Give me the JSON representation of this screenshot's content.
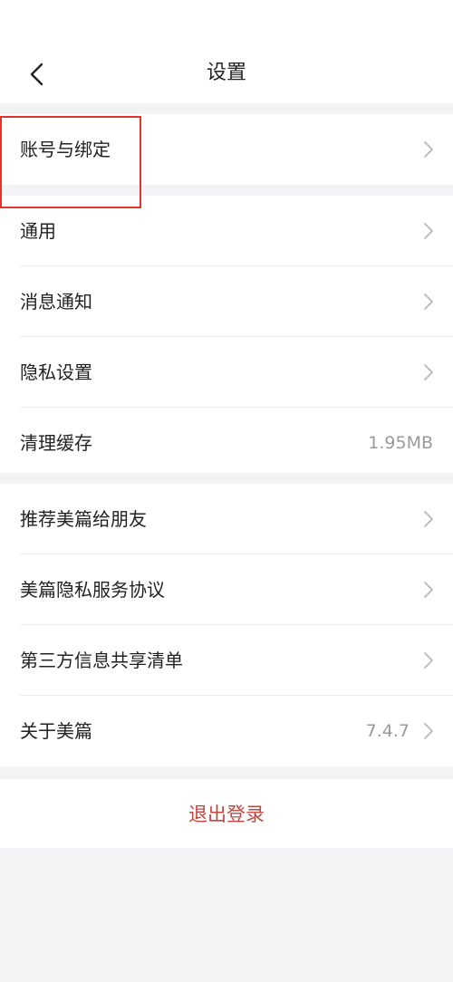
{
  "header": {
    "title": "设置"
  },
  "groups": {
    "account": [
      {
        "label": "账号与绑定"
      }
    ],
    "general": [
      {
        "label": "通用"
      },
      {
        "label": "消息通知"
      },
      {
        "label": "隐私设置"
      },
      {
        "label": "清理缓存",
        "value": "1.95MB"
      }
    ],
    "about": [
      {
        "label": "推荐美篇给朋友"
      },
      {
        "label": "美篇隐私服务协议"
      },
      {
        "label": "第三方信息共享清单"
      },
      {
        "label": "关于美篇",
        "value": "7.4.7"
      }
    ]
  },
  "logout": {
    "label": "退出登录",
    "color": "#c1463e"
  },
  "icons": {
    "back": "chevron-left-icon",
    "row_arrow": "chevron-right-icon"
  },
  "annotation": {
    "highlight_color": "#e0352b"
  }
}
